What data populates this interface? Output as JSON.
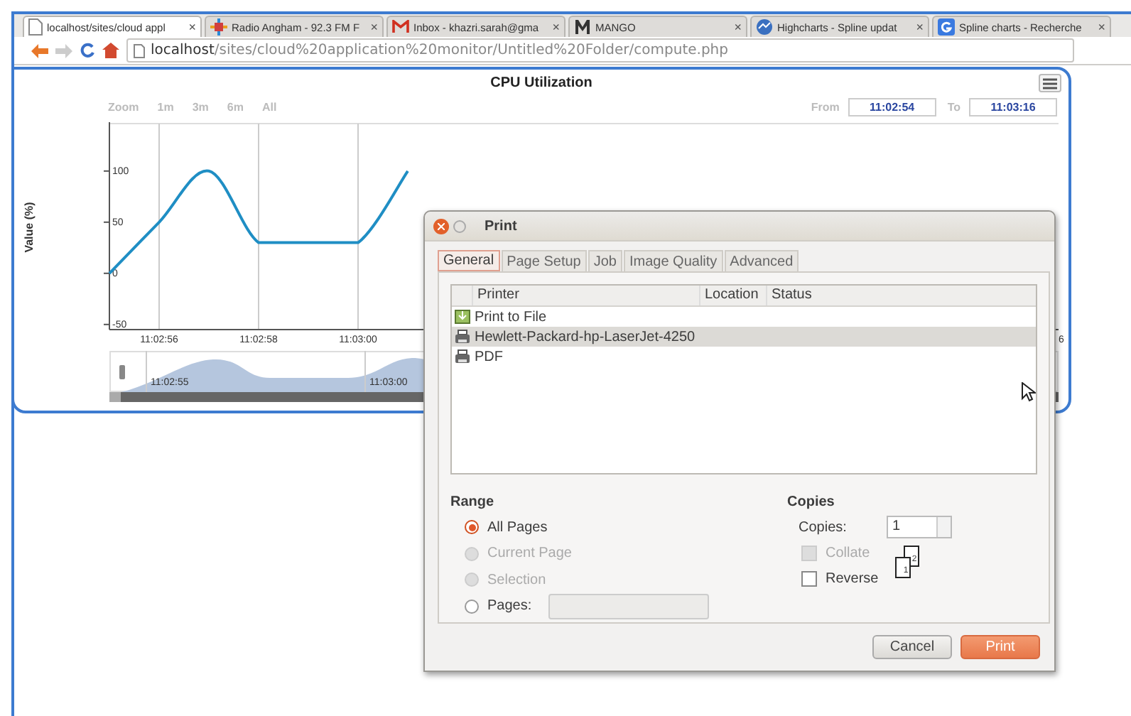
{
  "browser": {
    "tabs": [
      {
        "title": "localhost/sites/cloud appl",
        "kind": "page",
        "close": "×",
        "selected": true
      },
      {
        "title": "Radio Angham - 92.3 FM F",
        "kind": "radio",
        "close": "×",
        "selected": false
      },
      {
        "title": "Inbox - khazri.sarah@gma",
        "kind": "mail",
        "close": "×",
        "selected": false
      },
      {
        "title": "MANGO",
        "kind": "mango",
        "close": "×",
        "selected": false
      },
      {
        "title": "Highcharts - Spline updat",
        "kind": "highcharts",
        "close": "×",
        "selected": false
      },
      {
        "title": "Spline charts - Recherche",
        "kind": "google",
        "close": "×",
        "selected": false
      }
    ],
    "address": {
      "host": "localhost",
      "path": "/sites/cloud%20application%20monitor/Untitled%20Folder/compute.php"
    }
  },
  "chart": {
    "range_selector": {
      "label": "Zoom",
      "buttons": [
        "1m",
        "3m",
        "6m",
        "All"
      ]
    },
    "date_range": {
      "from_label": "From",
      "from": "11:02:54",
      "to_label": "To",
      "to": "11:03:16"
    },
    "chart_data": {
      "type": "line",
      "title": "CPU Utilization",
      "ylabel": "Value (%)",
      "categories": [
        null,
        "11:02:56",
        null,
        "11:02:58",
        null,
        "11:03:00",
        null
      ],
      "series": [
        {
          "color": "#1f8ec4",
          "values": [
            0,
            50,
            100,
            30,
            30,
            30,
            100
          ]
        }
      ],
      "ylim": [
        -55,
        145
      ],
      "yticks": [
        -50,
        0,
        50,
        100
      ],
      "grid": true
    },
    "x_label_fragment": "6",
    "navigator": {
      "labels": [
        "11:02:55",
        "11:03:00"
      ]
    }
  },
  "print_dialog": {
    "title": "Print",
    "tabs": [
      {
        "label": "General",
        "selected": true
      },
      {
        "label": "Page Setup",
        "selected": false
      },
      {
        "label": "Job",
        "selected": false
      },
      {
        "label": "Image Quality",
        "selected": false
      },
      {
        "label": "Advanced",
        "selected": false
      }
    ],
    "columns": [
      "Printer",
      "Location",
      "Status"
    ],
    "printers": [
      {
        "name": "Print to File",
        "kind": "file",
        "selected": false
      },
      {
        "name": "Hewlett-Packard-hp-LaserJet-4250",
        "kind": "printer",
        "selected": true
      },
      {
        "name": "PDF",
        "kind": "printer",
        "selected": false
      }
    ],
    "range": {
      "heading": "Range",
      "options": [
        {
          "label": "All Pages",
          "selected": true,
          "disabled": false
        },
        {
          "label": "Current Page",
          "selected": false,
          "disabled": true
        },
        {
          "label": "Selection",
          "selected": false,
          "disabled": true
        },
        {
          "label": "Pages:",
          "selected": false,
          "disabled": false,
          "kind": "pages"
        }
      ]
    },
    "copies": {
      "heading": "Copies",
      "label": "Copies:",
      "value": "1",
      "options": [
        {
          "label": "Collate",
          "checked": false,
          "disabled": true
        },
        {
          "label": "Reverse",
          "checked": false,
          "disabled": false
        }
      ],
      "page_numbers": [
        "1",
        "2"
      ]
    },
    "buttons": [
      {
        "label": "Cancel",
        "kind": "normal"
      },
      {
        "label": "Print",
        "kind": "default"
      }
    ]
  }
}
